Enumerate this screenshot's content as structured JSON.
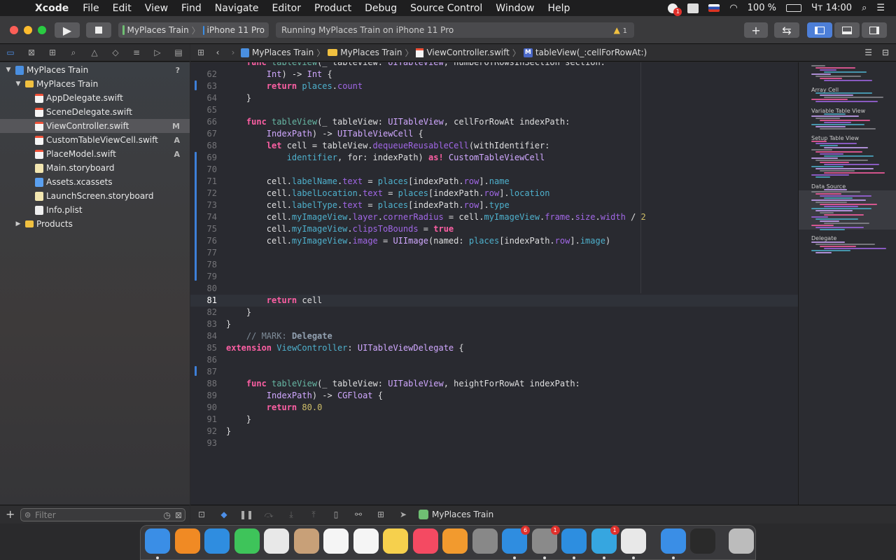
{
  "menubar": {
    "app": "Xcode",
    "items": [
      "File",
      "Edit",
      "View",
      "Find",
      "Navigate",
      "Editor",
      "Product",
      "Debug",
      "Source Control",
      "Window",
      "Help"
    ],
    "battery": "100 %",
    "clock": "Чт 14:00",
    "notif_badge": "1"
  },
  "toolbar": {
    "scheme": "MyPlaces Train",
    "device": "iPhone 11 Pro",
    "status": "Running MyPlaces Train on iPhone 11 Pro",
    "warnings": "1"
  },
  "navigator": {
    "rows": [
      {
        "label": "MyPlaces Train",
        "status": "?",
        "icon": "project-icon",
        "indent": 0,
        "tri": "▼"
      },
      {
        "label": "MyPlaces Train",
        "status": "",
        "icon": "folder-icon",
        "indent": 1,
        "tri": "▼"
      },
      {
        "label": "AppDelegate.swift",
        "status": "",
        "icon": "swift-file-icon",
        "indent": 2,
        "tri": ""
      },
      {
        "label": "SceneDelegate.swift",
        "status": "",
        "icon": "swift-file-icon",
        "indent": 2,
        "tri": ""
      },
      {
        "label": "ViewController.swift",
        "status": "M",
        "icon": "swift-file-icon",
        "indent": 2,
        "tri": "",
        "selected": true
      },
      {
        "label": "CustomTableViewCell.swift",
        "status": "A",
        "icon": "swift-file-icon",
        "indent": 2,
        "tri": ""
      },
      {
        "label": "PlaceModel.swift",
        "status": "A",
        "icon": "swift-file-icon",
        "indent": 2,
        "tri": ""
      },
      {
        "label": "Main.storyboard",
        "status": "",
        "icon": "storyboard-icon",
        "indent": 2,
        "tri": ""
      },
      {
        "label": "Assets.xcassets",
        "status": "",
        "icon": "assets-icon",
        "indent": 2,
        "tri": ""
      },
      {
        "label": "LaunchScreen.storyboard",
        "status": "",
        "icon": "storyboard-icon",
        "indent": 2,
        "tri": ""
      },
      {
        "label": "Info.plist",
        "status": "",
        "icon": "plist-icon",
        "indent": 2,
        "tri": ""
      },
      {
        "label": "Products",
        "status": "",
        "icon": "folder-icon",
        "indent": 1,
        "tri": "▶"
      }
    ],
    "filter_placeholder": "Filter"
  },
  "jumpbar": {
    "crumbs": [
      "MyPlaces Train",
      "MyPlaces Train",
      "ViewController.swift",
      "tableView(_:cellForRowAt:)"
    ]
  },
  "editor": {
    "current_line": "81",
    "lines": [
      {
        "n": "",
        "html": "    <span class='kw'>func</span> <span class='fn'>tableView</span>(_ tableView: <span class='ty'>UITableView</span>, numberOfRowsInSection section:"
      },
      {
        "n": "62",
        "html": "        <span class='ty'>Int</span>) -> <span class='ty'>Int</span> {"
      },
      {
        "n": "63",
        "html": "        <span class='kw'>return</span> <span class='idf'>places</span>.<span class='pr'>count</span>"
      },
      {
        "n": "64",
        "html": "    }"
      },
      {
        "n": "65",
        "html": ""
      },
      {
        "n": "66",
        "html": "    <span class='kw'>func</span> <span class='fn'>tableView</span>(_ tableView: <span class='ty'>UITableView</span>, cellForRowAt indexPath:"
      },
      {
        "n": "67",
        "html": "        <span class='ty'>IndexPath</span>) -> <span class='ty'>UITableViewCell</span> {"
      },
      {
        "n": "68",
        "html": "        <span class='kw'>let</span> cell = tableView.<span class='pr'>dequeueReusableCell</span>(withIdentifier:"
      },
      {
        "n": "69",
        "html": "            <span class='idf'>identifier</span>, for: indexPath) <span class='kw'>as!</span> <span class='ty'>CustomTableViewCell</span>"
      },
      {
        "n": "70",
        "html": ""
      },
      {
        "n": "71",
        "html": "        cell.<span class='idf'>labelName</span>.<span class='pr'>text</span> = <span class='idf'>places</span>[indexPath.<span class='pr'>row</span>].<span class='idf'>name</span>"
      },
      {
        "n": "72",
        "html": "        cell.<span class='idf'>labelLocation</span>.<span class='pr'>text</span> = <span class='idf'>places</span>[indexPath.<span class='pr'>row</span>].<span class='idf'>location</span>"
      },
      {
        "n": "73",
        "html": "        cell.<span class='idf'>labelType</span>.<span class='pr'>text</span> = <span class='idf'>places</span>[indexPath.<span class='pr'>row</span>].<span class='idf'>type</span>"
      },
      {
        "n": "74",
        "html": "        cell.<span class='idf'>myImageView</span>.<span class='pr'>layer</span>.<span class='pr'>cornerRadius</span> = cell.<span class='idf'>myImageView</span>.<span class='pr'>frame</span>.<span class='pr'>size</span>.<span class='pr'>width</span> / <span class='num'>2</span>"
      },
      {
        "n": "75",
        "html": "        cell.<span class='idf'>myImageView</span>.<span class='pr'>clipsToBounds</span> = <span class='kw'>true</span>"
      },
      {
        "n": "76",
        "html": "        cell.<span class='idf'>myImageView</span>.<span class='pr'>image</span> = <span class='ty'>UIImage</span>(named: <span class='idf'>places</span>[indexPath.<span class='pr'>row</span>].<span class='idf'>image</span>)"
      },
      {
        "n": "77",
        "html": ""
      },
      {
        "n": "78",
        "html": ""
      },
      {
        "n": "79",
        "html": ""
      },
      {
        "n": "80",
        "html": ""
      },
      {
        "n": "81",
        "html": "        <span class='kw'>return</span> cell"
      },
      {
        "n": "82",
        "html": "    }"
      },
      {
        "n": "83",
        "html": "}"
      },
      {
        "n": "84",
        "html": "    <span class='cm'>// MARK: </span><span class='mk'>Delegate</span>"
      },
      {
        "n": "85",
        "html": "<span class='kw'>extension</span> <span class='idf'>ViewController</span>: <span class='ty'>UITableViewDelegate</span> {"
      },
      {
        "n": "86",
        "html": ""
      },
      {
        "n": "87",
        "html": ""
      },
      {
        "n": "88",
        "html": "    <span class='kw'>func</span> <span class='fn'>tableView</span>(_ tableView: <span class='ty'>UITableView</span>, heightForRowAt indexPath:"
      },
      {
        "n": "89",
        "html": "        <span class='ty'>IndexPath</span>) -> <span class='ty'>CGFloat</span> {"
      },
      {
        "n": "90",
        "html": "        <span class='kw'>return</span> <span class='num'>80.0</span>"
      },
      {
        "n": "91",
        "html": "    }"
      },
      {
        "n": "92",
        "html": "}"
      },
      {
        "n": "93",
        "html": ""
      }
    ]
  },
  "minimap": {
    "headings": [
      "Array Cell",
      "Variable Table View",
      "Setup Table View",
      "Data Source",
      "Delegate"
    ]
  },
  "debugbar": {
    "target": "MyPlaces Train"
  },
  "dock": {
    "apps": [
      {
        "name": "finder",
        "color": "#3a8ee6"
      },
      {
        "name": "books",
        "color": "#f08a24"
      },
      {
        "name": "safari",
        "color": "#2f8de0"
      },
      {
        "name": "messages",
        "color": "#3ec45a"
      },
      {
        "name": "photos",
        "color": "#e8e8e8"
      },
      {
        "name": "contacts",
        "color": "#c8a078"
      },
      {
        "name": "calendar",
        "color": "#f5f5f5"
      },
      {
        "name": "reminders",
        "color": "#f5f5f5"
      },
      {
        "name": "notes",
        "color": "#f6d04d"
      },
      {
        "name": "music",
        "color": "#f44a62"
      },
      {
        "name": "pages",
        "color": "#f29a2e"
      },
      {
        "name": "calculator",
        "color": "#888888"
      },
      {
        "name": "app-store",
        "color": "#2f8de0",
        "badge": "6"
      },
      {
        "name": "system-preferences",
        "color": "#8a8a8a",
        "badge": "1"
      },
      {
        "name": "xcode",
        "color": "#2d8ee0"
      },
      {
        "name": "telegram",
        "color": "#36a6e0",
        "badge": "1"
      },
      {
        "name": "chrome",
        "color": "#e8e8e8"
      },
      {
        "name": "simulator",
        "color": "#3a8ee6"
      },
      {
        "name": "quicktime",
        "color": "#2a2a2a"
      },
      {
        "name": "trash",
        "color": "#bcbcbc"
      }
    ]
  }
}
